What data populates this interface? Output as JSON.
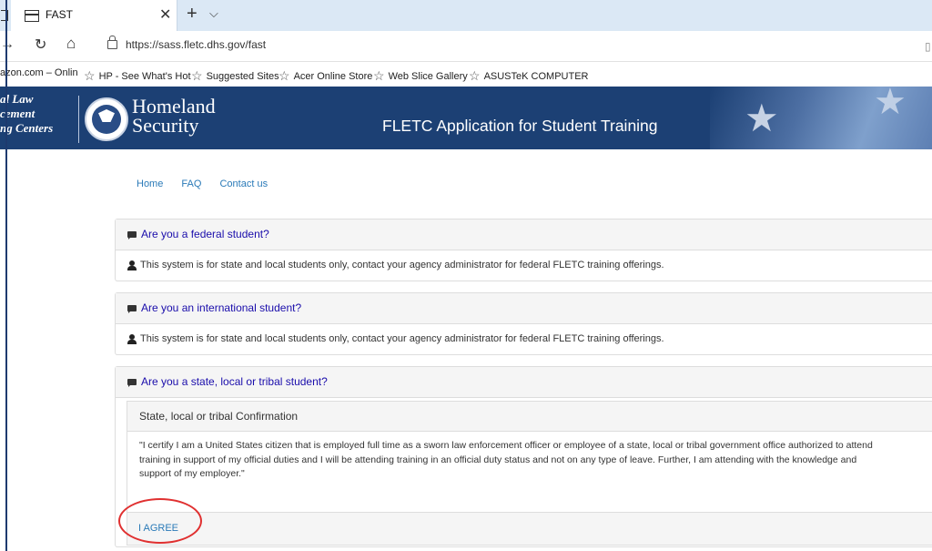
{
  "browser": {
    "tab_title": "FAST",
    "url": "https://sass.fletc.dhs.gov/fast",
    "favorites": [
      "azon.com – Onlin",
      "HP - See What's Hot",
      "Suggested Sites",
      "Acer Online Store",
      "Web Slice Gallery",
      "ASUSTeK COMPUTER"
    ]
  },
  "banner": {
    "left_text_lines": [
      "al Law",
      "cement",
      "ng Centers"
    ],
    "agency_line1": "Homeland",
    "agency_line2": "Security",
    "app_title": "FLETC Application for Student Training"
  },
  "nav": {
    "links": [
      "Home",
      "FAQ",
      "Contact us"
    ]
  },
  "panels": [
    {
      "question": "Are you a federal student?",
      "message": "This system is for state and local students only, contact your agency administrator for federal FLETC training offerings."
    },
    {
      "question": "Are you an international student?",
      "message": "This system is for state and local students only, contact your agency administrator for federal FLETC training offerings."
    },
    {
      "question": "Are you a state, local or tribal student?",
      "confirmation_title": "State, local or tribal Confirmation",
      "confirmation_text_lines": [
        "\"I certify I am a United States citizen that is employed full time as a sworn law enforcement officer or employee of a state, local or tribal government office authorized to attend",
        "training in support of my official duties and I will be attending training in an official duty status and not on any type of leave. Further, I am attending with the knowledge and",
        "support of my employer.\""
      ],
      "agree_label": "I AGREE"
    }
  ],
  "colors": {
    "banner_bg": "#1c4074",
    "link": "#2a7ab8",
    "panel_title": "#1a0dab",
    "annotation_circle": "#e03030"
  }
}
